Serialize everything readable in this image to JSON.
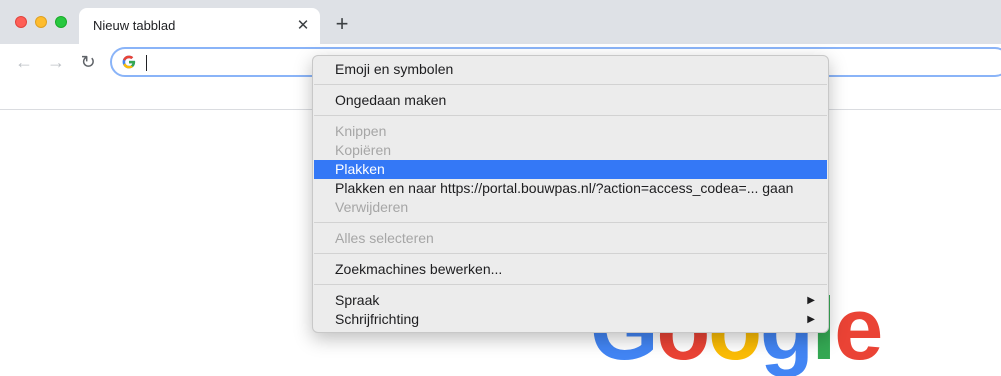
{
  "window": {
    "tab": {
      "title": "Nieuw tabblad",
      "close_glyph": "✕"
    },
    "new_tab_glyph": "+"
  },
  "toolbar": {
    "back_glyph": "←",
    "forward_glyph": "→",
    "reload_glyph": "↻",
    "omnibox_value": ""
  },
  "google_logo": [
    "G",
    "o",
    "o",
    "g",
    "l",
    "e"
  ],
  "colors": {
    "menu_highlight": "#3478f6",
    "google_blue": "#4285f4",
    "google_red": "#ea4335",
    "google_yellow": "#fbbc05",
    "google_green": "#34a853"
  },
  "context_menu": {
    "emoji": "Emoji en symbolen",
    "undo": "Ongedaan maken",
    "cut": "Knippen",
    "copy": "Kopiëren",
    "paste": "Plakken",
    "paste_and_go": "Plakken en naar https://portal.bouwpas.nl/?action=access_codea=... gaan",
    "delete": "Verwijderen",
    "select_all": "Alles selecteren",
    "edit_search_engines": "Zoekmachines bewerken...",
    "speech": "Spraak",
    "writing_direction": "Schrijfrichting",
    "submenu_arrow": "▶"
  }
}
